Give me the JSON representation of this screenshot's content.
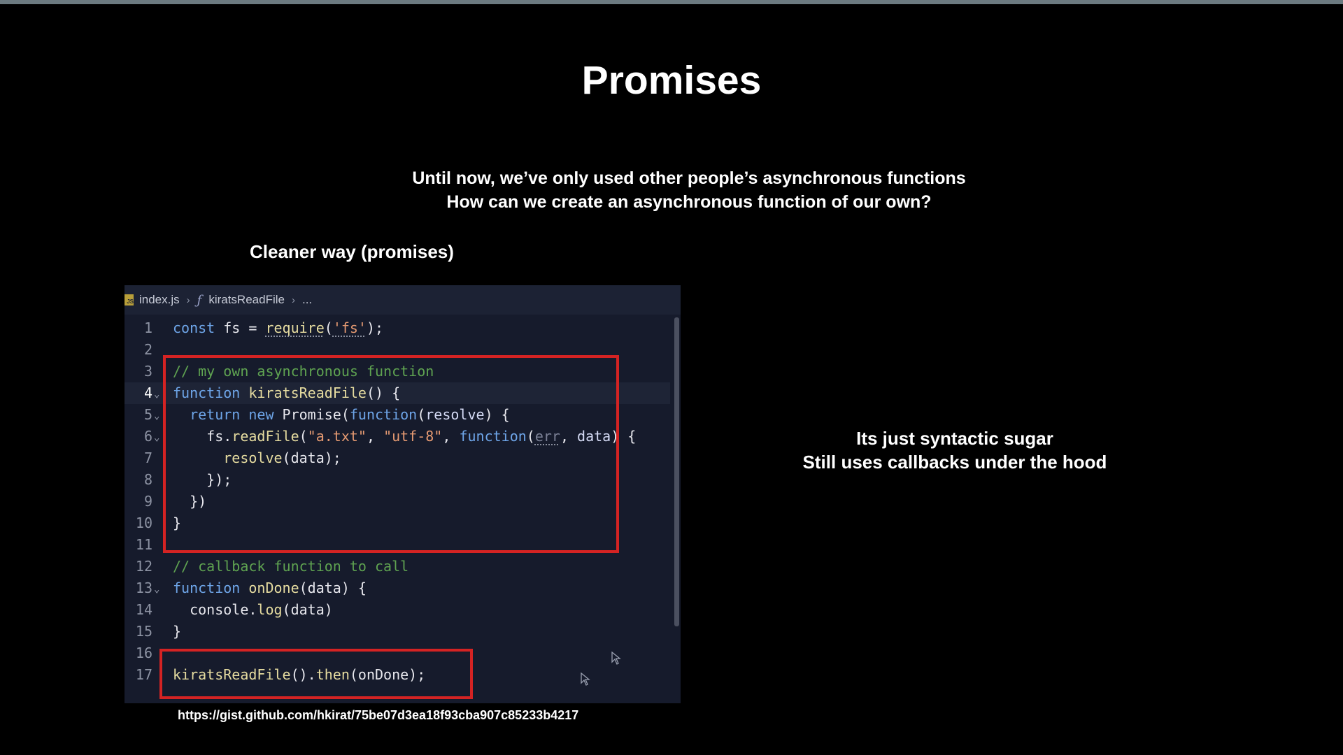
{
  "slide": {
    "title": "Promises",
    "subtitle_line1": "Until now, we’ve only used other people’s asynchronous functions",
    "subtitle_line2": "How can we create an asynchronous function of our own?",
    "left_heading": "Cleaner way (promises)",
    "right_note_line1": "Its just syntactic sugar",
    "right_note_line2": "Still uses callbacks under the hood",
    "link": "https://gist.github.com/hkirat/75be07d3ea18f93cba907c85233b4217"
  },
  "editor": {
    "breadcrumb": {
      "file_icon": "js-file-icon",
      "file": "index.js",
      "symbol_icon": "function-icon",
      "symbol": "kiratsReadFile",
      "more": "..."
    },
    "current_line": 4,
    "lines": [
      {
        "n": "1",
        "fold": false,
        "tokens": [
          {
            "t": "const",
            "c": "kw"
          },
          {
            "t": " fs = ",
            "c": "plain"
          },
          {
            "t": "require",
            "c": "fn",
            "squig": true
          },
          {
            "t": "(",
            "c": "plain"
          },
          {
            "t": "'fs'",
            "c": "str",
            "squig": true
          },
          {
            "t": ");",
            "c": "plain"
          }
        ]
      },
      {
        "n": "2",
        "fold": false,
        "tokens": []
      },
      {
        "n": "3",
        "fold": false,
        "tokens": [
          {
            "t": "// my own asynchronous function",
            "c": "com"
          }
        ]
      },
      {
        "n": "4",
        "fold": true,
        "tokens": [
          {
            "t": "function",
            "c": "kw"
          },
          {
            "t": " ",
            "c": "plain"
          },
          {
            "t": "kiratsReadFile",
            "c": "fn"
          },
          {
            "t": "() {",
            "c": "plain"
          }
        ]
      },
      {
        "n": "5",
        "fold": true,
        "tokens": [
          {
            "t": "  ",
            "c": "plain"
          },
          {
            "t": "return",
            "c": "kw"
          },
          {
            "t": " ",
            "c": "plain"
          },
          {
            "t": "new",
            "c": "kw"
          },
          {
            "t": " Promise(",
            "c": "plain"
          },
          {
            "t": "function",
            "c": "kw"
          },
          {
            "t": "(",
            "c": "plain"
          },
          {
            "t": "resolve",
            "c": "param"
          },
          {
            "t": ") {",
            "c": "plain"
          }
        ]
      },
      {
        "n": "6",
        "fold": true,
        "tokens": [
          {
            "t": "    fs.",
            "c": "plain"
          },
          {
            "t": "readFile",
            "c": "fn"
          },
          {
            "t": "(",
            "c": "plain"
          },
          {
            "t": "\"a.txt\"",
            "c": "str"
          },
          {
            "t": ", ",
            "c": "plain"
          },
          {
            "t": "\"utf-8\"",
            "c": "str"
          },
          {
            "t": ", ",
            "c": "plain"
          },
          {
            "t": "function",
            "c": "kw"
          },
          {
            "t": "(",
            "c": "plain"
          },
          {
            "t": "err",
            "c": "unused",
            "squig": true
          },
          {
            "t": ", ",
            "c": "plain"
          },
          {
            "t": "data",
            "c": "param"
          },
          {
            "t": ") {",
            "c": "plain"
          }
        ]
      },
      {
        "n": "7",
        "fold": false,
        "tokens": [
          {
            "t": "      ",
            "c": "plain"
          },
          {
            "t": "resolve",
            "c": "fn"
          },
          {
            "t": "(data);",
            "c": "plain"
          }
        ]
      },
      {
        "n": "8",
        "fold": false,
        "tokens": [
          {
            "t": "    });",
            "c": "plain"
          }
        ]
      },
      {
        "n": "9",
        "fold": false,
        "tokens": [
          {
            "t": "  })",
            "c": "plain"
          }
        ]
      },
      {
        "n": "10",
        "fold": false,
        "tokens": [
          {
            "t": "}",
            "c": "plain"
          }
        ]
      },
      {
        "n": "11",
        "fold": false,
        "tokens": []
      },
      {
        "n": "12",
        "fold": false,
        "tokens": [
          {
            "t": "// callback function to call",
            "c": "com"
          }
        ]
      },
      {
        "n": "13",
        "fold": true,
        "tokens": [
          {
            "t": "function",
            "c": "kw"
          },
          {
            "t": " ",
            "c": "plain"
          },
          {
            "t": "onDone",
            "c": "fn"
          },
          {
            "t": "(data) {",
            "c": "plain"
          }
        ]
      },
      {
        "n": "14",
        "fold": false,
        "tokens": [
          {
            "t": "  console.",
            "c": "plain"
          },
          {
            "t": "log",
            "c": "fn"
          },
          {
            "t": "(data)",
            "c": "plain"
          }
        ]
      },
      {
        "n": "15",
        "fold": false,
        "tokens": [
          {
            "t": "}",
            "c": "plain"
          }
        ]
      },
      {
        "n": "16",
        "fold": false,
        "tokens": []
      },
      {
        "n": "17",
        "fold": false,
        "tokens": [
          {
            "t": "kiratsReadFile",
            "c": "fn"
          },
          {
            "t": "().",
            "c": "plain"
          },
          {
            "t": "then",
            "c": "fn"
          },
          {
            "t": "(onDone);",
            "c": "plain"
          }
        ]
      }
    ]
  },
  "colors": {
    "background": "#000000",
    "editor_bg": "#161b2c",
    "highlight_border": "#d42323",
    "keyword": "#6ea5e8",
    "function": "#e6dca0",
    "string": "#e59a72",
    "comment": "#5fa351"
  }
}
